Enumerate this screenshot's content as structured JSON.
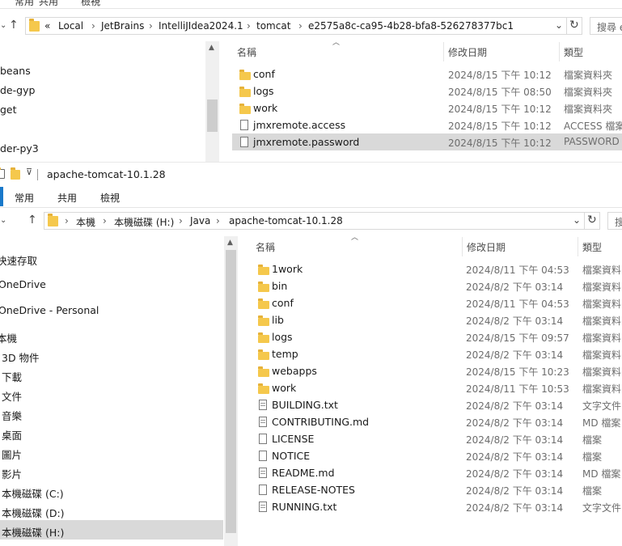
{
  "top_window": {
    "ribbon_tabs": [
      "常用",
      "共用",
      "檢視"
    ],
    "path": [
      "«",
      "Local",
      "JetBrains",
      "IntelliJIdea2024.1",
      "tomcat",
      "e2575a8c-ca95-4b28-bfa8-526278377bc1"
    ],
    "search_placeholder": "搜尋 e",
    "nav_items": [
      "beans",
      "de-gyp",
      "get",
      "der-py3"
    ],
    "columns": {
      "name": "名稱",
      "date": "修改日期",
      "type": "類型"
    },
    "files": [
      {
        "name": "conf",
        "date": "2024/8/15 下午 10:12",
        "type": "檔案資料夾",
        "kind": "folder"
      },
      {
        "name": "logs",
        "date": "2024/8/15 下午 08:50",
        "type": "檔案資料夾",
        "kind": "folder"
      },
      {
        "name": "work",
        "date": "2024/8/15 下午 10:12",
        "type": "檔案資料夾",
        "kind": "folder"
      },
      {
        "name": "jmxremote.access",
        "date": "2024/8/15 下午 10:12",
        "type": "ACCESS 檔案",
        "kind": "file"
      },
      {
        "name": "jmxremote.password",
        "date": "2024/8/15 下午 10:12",
        "type": "PASSWORD",
        "kind": "file"
      }
    ]
  },
  "bottom_window": {
    "title": "apache-tomcat-10.1.28",
    "ribbon_tabs": [
      "常用",
      "共用",
      "檢視"
    ],
    "path": [
      "本機",
      "本機磁碟 (H:)",
      "Java",
      "apache-tomcat-10.1.28"
    ],
    "search_placeholder": "搜",
    "nav_items": [
      "快速存取",
      "OneDrive",
      "OneDrive - Personal",
      "本機",
      "3D 物件",
      "下載",
      "文件",
      "音樂",
      "桌面",
      "圖片",
      "影片",
      "本機磁碟 (C:)",
      "本機磁碟 (D:)",
      "本機磁碟 (H:)"
    ],
    "columns": {
      "name": "名稱",
      "date": "修改日期",
      "type": "類型"
    },
    "files": [
      {
        "name": "1work",
        "date": "2024/8/11 下午 04:53",
        "type": "檔案資料",
        "kind": "folder"
      },
      {
        "name": "bin",
        "date": "2024/8/2 下午 03:14",
        "type": "檔案資料",
        "kind": "folder"
      },
      {
        "name": "conf",
        "date": "2024/8/11 下午 04:53",
        "type": "檔案資料",
        "kind": "folder"
      },
      {
        "name": "lib",
        "date": "2024/8/2 下午 03:14",
        "type": "檔案資料",
        "kind": "folder"
      },
      {
        "name": "logs",
        "date": "2024/8/15 下午 09:57",
        "type": "檔案資料",
        "kind": "folder"
      },
      {
        "name": "temp",
        "date": "2024/8/2 下午 03:14",
        "type": "檔案資料",
        "kind": "folder"
      },
      {
        "name": "webapps",
        "date": "2024/8/15 下午 10:23",
        "type": "檔案資料",
        "kind": "folder"
      },
      {
        "name": "work",
        "date": "2024/8/11 下午 10:53",
        "type": "檔案資料",
        "kind": "folder"
      },
      {
        "name": "BUILDING.txt",
        "date": "2024/8/2 下午 03:14",
        "type": "文字文件",
        "kind": "text"
      },
      {
        "name": "CONTRIBUTING.md",
        "date": "2024/8/2 下午 03:14",
        "type": "MD 檔案",
        "kind": "text"
      },
      {
        "name": "LICENSE",
        "date": "2024/8/2 下午 03:14",
        "type": "檔案",
        "kind": "file"
      },
      {
        "name": "NOTICE",
        "date": "2024/8/2 下午 03:14",
        "type": "檔案",
        "kind": "file"
      },
      {
        "name": "README.md",
        "date": "2024/8/2 下午 03:14",
        "type": "MD 檔案",
        "kind": "text"
      },
      {
        "name": "RELEASE-NOTES",
        "date": "2024/8/2 下午 03:14",
        "type": "檔案",
        "kind": "file"
      },
      {
        "name": "RUNNING.txt",
        "date": "2024/8/2 下午 03:14",
        "type": "文字文件",
        "kind": "text"
      }
    ]
  }
}
